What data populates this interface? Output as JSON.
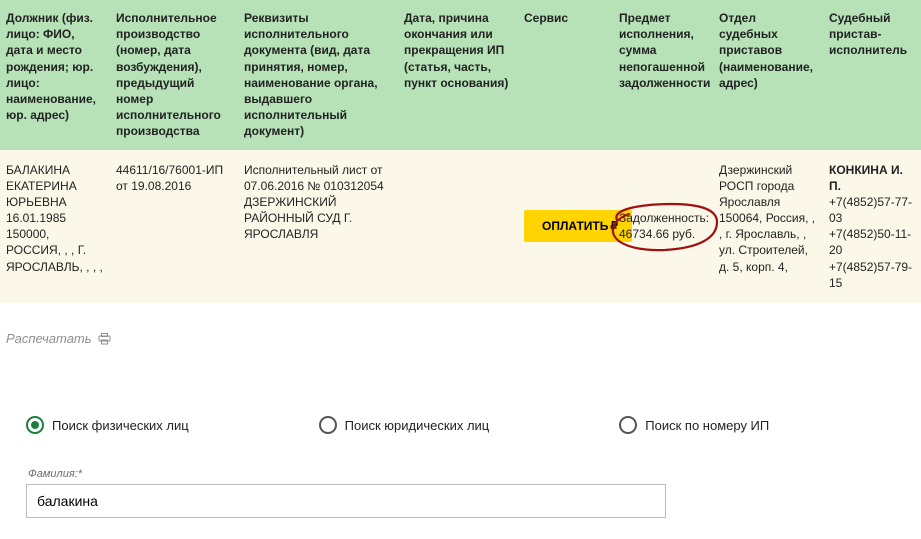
{
  "columns": {
    "c1": "Должник (физ. лицо: ФИО, дата и место рождения; юр. лицо: наименование, юр. адрес)",
    "c2": "Исполнительное производство (номер, дата возбуждения), предыдущий номер исполнительного производства",
    "c3": "Реквизиты исполнительного документа (вид, дата принятия, номер, наименование органа, выдавшего исполнительный документ)",
    "c4": "Дата, причина окончания или прекращения ИП (статья, часть, пункт основания)",
    "c5": "Сервис",
    "c6": "Предмет исполнения, сумма непогашенной задолженности",
    "c7": "Отдел судебных приставов (наименование, адрес)",
    "c8": "Судебный пристав-исполнитель"
  },
  "row": {
    "debtor": "БАЛАКИНА ЕКАТЕРИНА ЮРЬЕВНА 16.01.1985 150000, РОССИЯ, , , Г. ЯРОСЛАВЛЬ, , , ,",
    "proceeding": "44611/16/76001-ИП от 19.08.2016",
    "document": "Исполнительный лист от 07.06.2016 № 010312054 ДЗЕРЖИНСКИЙ РАЙОННЫЙ СУД Г. ЯРОСЛАВЛЯ",
    "end_reason": "",
    "pay_label": "ОПЛАТИТЬ",
    "debt": "Задолженность: 46734.66 руб.",
    "department": "Дзержинский РОСП города Ярославля 150064, Россия, , , г. Ярославль, , ул. Строителей, д. 5, корп. 4,",
    "bailiff": "КОНКИНА И. П.",
    "phones": "+7(4852)57-77-03\n+7(4852)50-11-20\n+7(4852)57-79-15"
  },
  "print_label": "Распечатать",
  "search": {
    "opt1": "Поиск физических лиц",
    "opt2": "Поиск юридических лиц",
    "opt3": "Поиск по номеру ИП",
    "lastname_label": "Фамилия:*",
    "lastname_value": "балакина"
  }
}
